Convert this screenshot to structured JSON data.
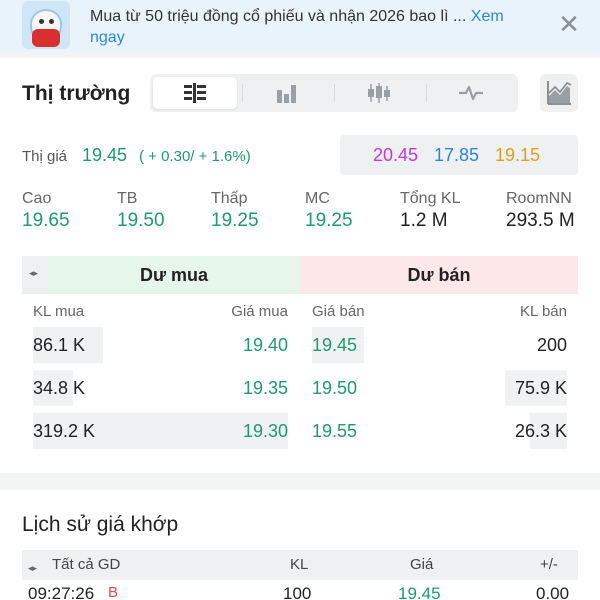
{
  "banner": {
    "text": "Mua từ 50 triệu đồng cổ phiếu và nhận 2026 bao lì ...",
    "link": "Xem ngay",
    "close_icon": "close-icon"
  },
  "market": {
    "title": "Thị trường",
    "tabs": [
      "order-book-icon",
      "volume-bars-icon",
      "candlestick-icon",
      "line-wave-icon"
    ],
    "active_tab": 0,
    "chart_button_icon": "area-chart-icon"
  },
  "quote": {
    "price_label": "Thị giá",
    "price": "19.45",
    "change": "( + 0.30/ + 1.6%)",
    "ceiling": "20.45",
    "floor": "17.85",
    "reference": "19.15",
    "colors": {
      "up": "#1e9a6c",
      "ceiling": "#c23ad4",
      "floor": "#2b86d9",
      "reference": "#d9a21a",
      "down": "#e04b4b"
    }
  },
  "stats": [
    {
      "label": "Cao",
      "value": "19.65",
      "color": "#1e9a6c"
    },
    {
      "label": "TB",
      "value": "19.50",
      "color": "#1e9a6c"
    },
    {
      "label": "Thấp",
      "value": "19.25",
      "color": "#1e9a6c"
    },
    {
      "label": "MC",
      "value": "19.25",
      "color": "#1e9a6c"
    },
    {
      "label": "Tổng KL",
      "value": "1.2 M",
      "color": "#222222"
    },
    {
      "label": "RoomNN",
      "value": "293.5 M",
      "color": "#222222"
    }
  ],
  "order_book": {
    "bid_header": "Dư mua",
    "ask_header": "Dư bán",
    "columns": {
      "bid_vol": "KL mua",
      "bid_price": "Giá mua",
      "ask_price": "Giá bán",
      "ask_vol": "KL bán"
    },
    "rows": [
      {
        "bid_vol": "86.1 K",
        "bid_price": "19.40",
        "ask_price": "19.45",
        "ask_vol": "200"
      },
      {
        "bid_vol": "34.8 K",
        "bid_price": "19.35",
        "ask_price": "19.50",
        "ask_vol": "75.9 K"
      },
      {
        "bid_vol": "319.2 K",
        "bid_price": "19.30",
        "ask_price": "19.55",
        "ask_vol": "26.3 K"
      }
    ]
  },
  "history": {
    "title": "Lịch sử giá khớp",
    "columns": {
      "filter": "Tất cả GD",
      "volume": "KL",
      "price": "Giá",
      "change": "+/-"
    },
    "rows": [
      {
        "time": "09:27:26",
        "side": "B",
        "volume": "100",
        "price": "19.45",
        "change": "0.00"
      }
    ]
  }
}
